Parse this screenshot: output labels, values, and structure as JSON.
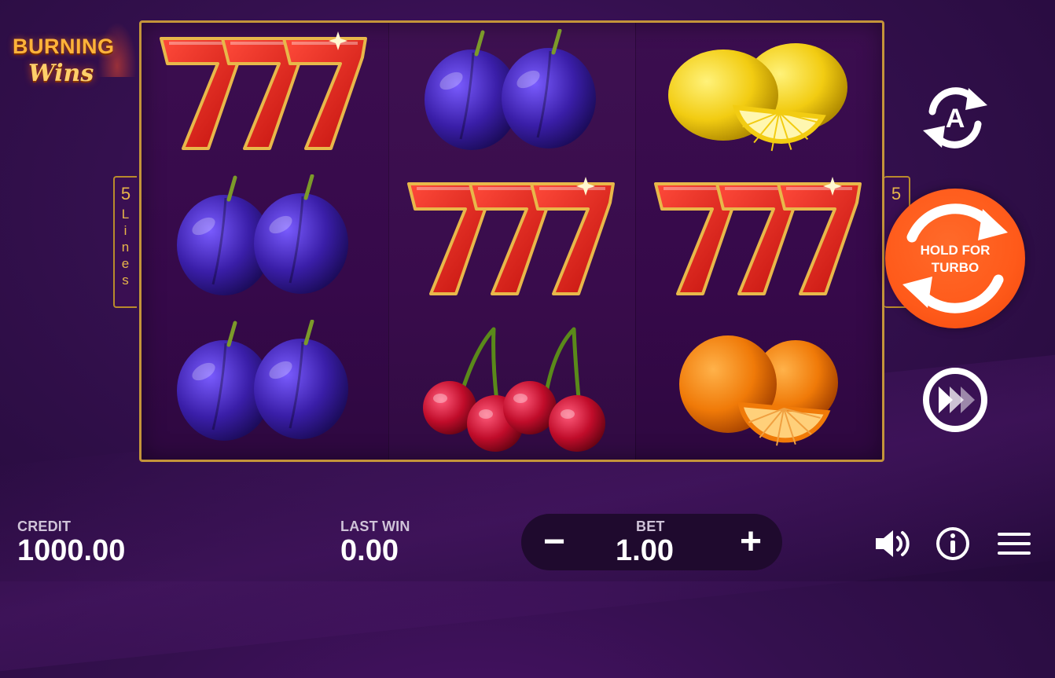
{
  "logo": {
    "line1": "BURNING",
    "line2": "Wins"
  },
  "lines_indicator": {
    "count": "5",
    "word": "Lines"
  },
  "reels": [
    [
      "seven",
      "plum",
      "plum"
    ],
    [
      "plum",
      "seven",
      "cherry"
    ],
    [
      "lemon",
      "seven",
      "orange"
    ]
  ],
  "controls": {
    "autoplay_letter": "A",
    "spin_label_line1": "HOLD FOR",
    "spin_label_line2": "TURBO"
  },
  "footer": {
    "credit_label": "CREDIT",
    "credit_value": "1000.00",
    "last_win_label": "LAST WIN",
    "last_win_value": "0.00",
    "bet_label": "BET",
    "bet_value": "1.00",
    "minus_symbol": "−",
    "plus_symbol": "+"
  },
  "icons": {
    "sound": "speaker-icon",
    "info": "info-icon",
    "menu": "hamburger-menu-icon"
  },
  "colors": {
    "frame_gold": "#c4943a",
    "spin_orange": "#ff5a1a",
    "background_purple": "#34104e"
  }
}
